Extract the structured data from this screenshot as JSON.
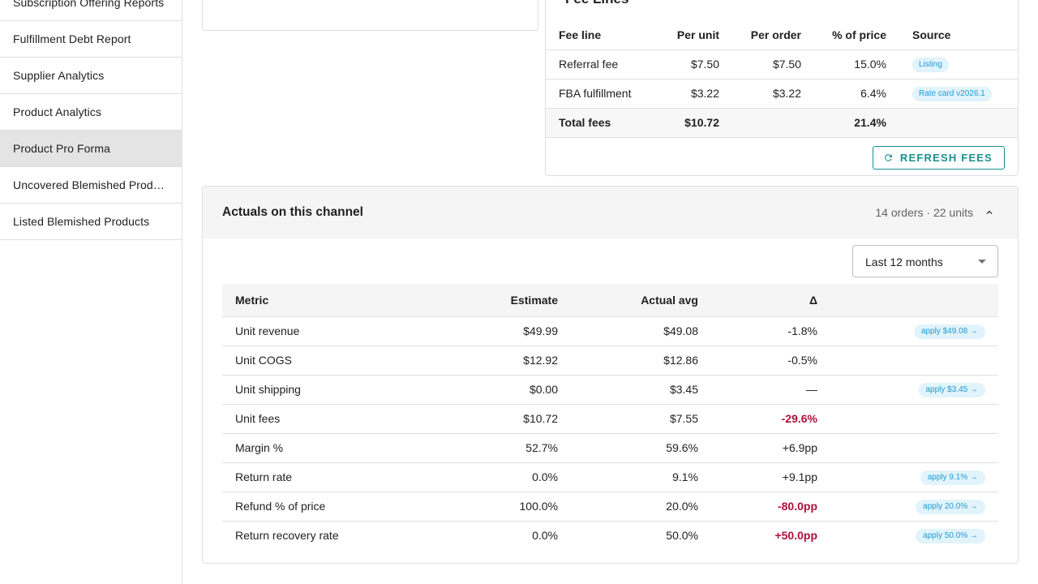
{
  "sidebar": {
    "items": [
      {
        "label": "Subscription Offering Reports",
        "active": false
      },
      {
        "label": "Fulfillment Debt Report",
        "active": false
      },
      {
        "label": "Supplier Analytics",
        "active": false
      },
      {
        "label": "Product Analytics",
        "active": false
      },
      {
        "label": "Product Pro Forma",
        "active": true
      },
      {
        "label": "Uncovered Blemished Products",
        "active": false
      },
      {
        "label": "Listed Blemished Products",
        "active": false
      }
    ]
  },
  "fee_card": {
    "title": "Fee Lines",
    "headers": {
      "fee_line": "Fee line",
      "per_unit": "Per unit",
      "per_order": "Per order",
      "pct_price": "% of price",
      "source": "Source"
    },
    "rows": [
      {
        "fee_line": "Referral fee",
        "per_unit": "$7.50",
        "per_order": "$7.50",
        "pct_price": "15.0%",
        "source": "Listing"
      },
      {
        "fee_line": "FBA fulfillment",
        "per_unit": "$3.22",
        "per_order": "$3.22",
        "pct_price": "6.4%",
        "source": "Rate card v2026.1"
      }
    ],
    "total": {
      "label": "Total fees",
      "per_unit": "$10.72",
      "pct_price": "21.4%"
    },
    "refresh_label": "REFRESH FEES"
  },
  "actuals": {
    "title": "Actuals on this channel",
    "meta": "14 orders · 22 units",
    "period": "Last 12 months",
    "headers": {
      "metric": "Metric",
      "estimate": "Estimate",
      "actual": "Actual avg",
      "delta": "Δ"
    },
    "rows": [
      {
        "metric": "Unit revenue",
        "estimate": "$49.99",
        "actual": "$49.08",
        "delta": "-1.8%",
        "flag": false,
        "apply": "apply $49.08 →"
      },
      {
        "metric": "Unit COGS",
        "estimate": "$12.92",
        "actual": "$12.86",
        "delta": "-0.5%",
        "flag": false,
        "apply": ""
      },
      {
        "metric": "Unit shipping",
        "estimate": "$0.00",
        "actual": "$3.45",
        "delta": "—",
        "flag": false,
        "apply": "apply $3.45 →"
      },
      {
        "metric": "Unit fees",
        "estimate": "$10.72",
        "actual": "$7.55",
        "delta": "-29.6%",
        "flag": true,
        "apply": ""
      },
      {
        "metric": "Margin %",
        "estimate": "52.7%",
        "actual": "59.6%",
        "delta": "+6.9pp",
        "flag": false,
        "apply": ""
      },
      {
        "metric": "Return rate",
        "estimate": "0.0%",
        "actual": "9.1%",
        "delta": "+9.1pp",
        "flag": false,
        "apply": "apply 9.1% →"
      },
      {
        "metric": "Refund % of price",
        "estimate": "100.0%",
        "actual": "20.0%",
        "delta": "-80.0pp",
        "flag": true,
        "apply": "apply 20.0% →"
      },
      {
        "metric": "Return recovery rate",
        "estimate": "0.0%",
        "actual": "50.0%",
        "delta": "+50.0pp",
        "flag": true,
        "apply": "apply 50.0% →"
      }
    ]
  }
}
